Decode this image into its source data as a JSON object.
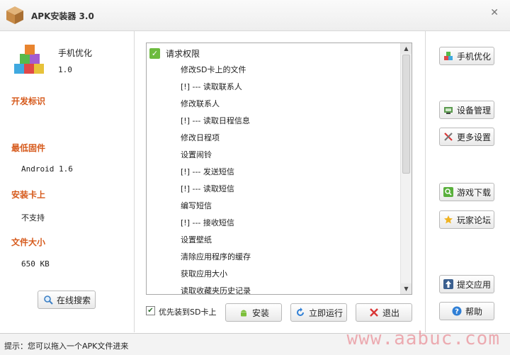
{
  "window": {
    "title": "APK安装器 3.0",
    "close_glyph": "✕"
  },
  "app": {
    "name": "手机优化",
    "version": "1.0",
    "labels": {
      "developer": "开发标识",
      "min_firmware": "最低固件",
      "install_sd": "安装卡上",
      "file_size": "文件大小"
    },
    "values": {
      "developer": "",
      "min_firmware": "Android 1.6",
      "install_sd": "不支持",
      "file_size": "650 KB"
    }
  },
  "buttons": {
    "online_search": "在线搜索",
    "install": "安装",
    "run_now": "立即运行",
    "exit": "退出"
  },
  "checkbox": {
    "sd_first_label": "优先装到SD卡上",
    "checked": true
  },
  "permissions": {
    "header": "请求权限",
    "items": [
      "修改SD卡上的文件",
      "[!] --- 读取联系人",
      "修改联系人",
      "[!] --- 读取日程信息",
      "修改日程项",
      "设置闹铃",
      "[!] --- 发送短信",
      "[!] --- 读取短信",
      "编写短信",
      "[!] --- 接收短信",
      "设置壁纸",
      "清除应用程序的缓存",
      "获取应用大小",
      "读取收藏夹历史记录"
    ]
  },
  "sidebar": {
    "phone_optimize": "手机优化",
    "device_manage": "设备管理",
    "more_settings": "更多设置",
    "game_download": "游戏下载",
    "player_forum": "玩家论坛",
    "submit_app": "提交应用",
    "help": "帮助"
  },
  "status": {
    "text": "提示：您可以拖入一个APK文件进来",
    "watermark": "www.aabuc.com"
  },
  "colors": {
    "accent_label": "#d65a1c",
    "check_green": "#6dbb3e"
  }
}
